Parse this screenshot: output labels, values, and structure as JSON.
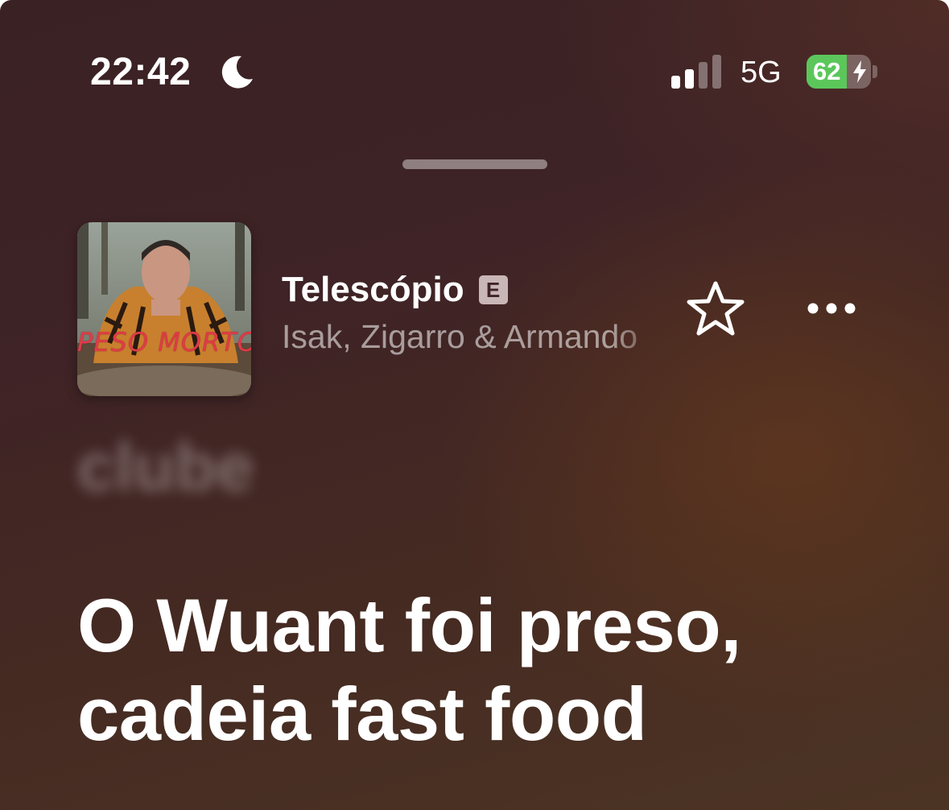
{
  "status_bar": {
    "time": "22:42",
    "focus_icon": "moon-icon",
    "signal_icon": "cellular-signal-icon",
    "signal_bars_active": 2,
    "signal_bars_total": 4,
    "network": "5G",
    "battery_percent": "62",
    "battery_level": 0.62,
    "battery_charging": true,
    "battery_color": "#5bc75b"
  },
  "now_playing": {
    "artwork_icon": "album-artwork",
    "artwork_caption": "PESO MORTO",
    "title": "Telescópio",
    "explicit_badge": "E",
    "artists": "Isak, Zigarro & Armando",
    "favorite_icon": "star-icon",
    "more_icon": "ellipsis-icon"
  },
  "lyrics": {
    "previous_line": "clube",
    "current_lines": [
      "O Wuant foi preso,",
      "cadeia fast food"
    ]
  },
  "colors": {
    "background_dark": "#3f2326",
    "background_warm": "#6e3e1c",
    "text_primary": "#ffffff",
    "text_secondary": "rgba(255,255,255,0.55)"
  }
}
